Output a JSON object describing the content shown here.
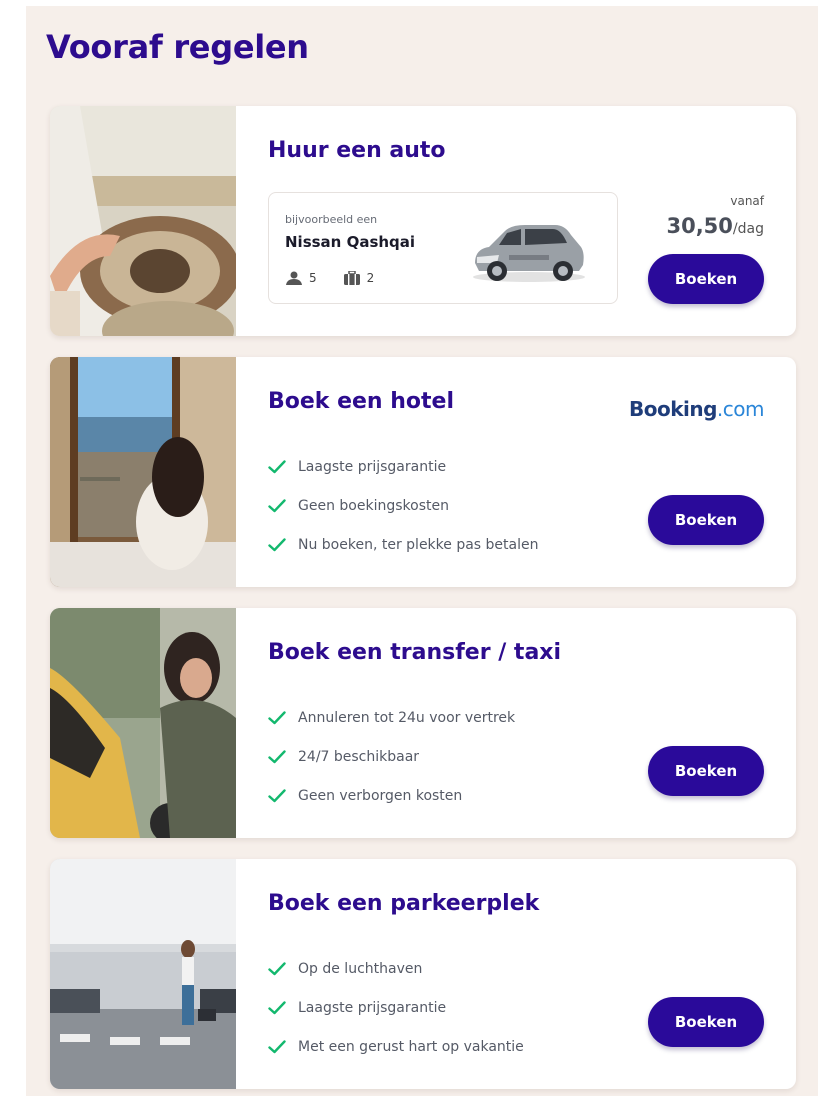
{
  "page_title": "Vooraf regelen",
  "colors": {
    "brand": "#2d0c8e",
    "button": "#2a0a9a",
    "check": "#13b86e",
    "background": "#f6efea"
  },
  "cards": {
    "car": {
      "title": "Huur een auto",
      "example_label": "bijvoorbeeld een",
      "model": "Nissan Qashqai",
      "passengers": "5",
      "bags": "2",
      "price_prefix": "vanaf",
      "price": "30,50",
      "price_unit": "/dag",
      "button": "Boeken"
    },
    "hotel": {
      "title": "Boek een hotel",
      "partner_name": "Booking",
      "partner_tld": ".com",
      "features": [
        "Laagste prijsgarantie",
        "Geen boekingskosten",
        "Nu boeken, ter plekke pas betalen"
      ],
      "button": "Boeken"
    },
    "transfer": {
      "title": "Boek een transfer / taxi",
      "features": [
        "Annuleren tot 24u voor vertrek",
        "24/7 beschikbaar",
        "Geen verborgen kosten"
      ],
      "button": "Boeken"
    },
    "parking": {
      "title": "Boek een parkeerplek",
      "features": [
        "Op de luchthaven",
        "Laagste prijsgarantie",
        "Met een gerust hart op vakantie"
      ],
      "button": "Boeken"
    }
  }
}
